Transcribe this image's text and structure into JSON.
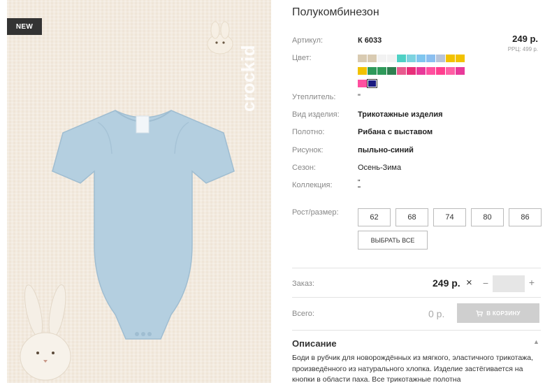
{
  "image": {
    "badge": "NEW",
    "watermark": "crockid",
    "product_color": "#b4cfe0"
  },
  "product": {
    "title": "Полукомбинезон",
    "price": "249 р.",
    "rrc": "РРЦ: 499 р."
  },
  "attributes": [
    {
      "label": "Артикул:",
      "value": "К 6033"
    },
    {
      "label": "Цвет:",
      "value": ""
    },
    {
      "label": "Утеплитель:",
      "value": "\""
    },
    {
      "label": "Вид изделия:",
      "value": "Трикотажные изделия"
    },
    {
      "label": "Полотно:",
      "value": "Рибана с выставом"
    },
    {
      "label": "Рисунок:",
      "value": "пыльно-синий"
    },
    {
      "label": "Сезон:",
      "value": "Осень-Зима"
    },
    {
      "label": "Коллекция:",
      "value": "\""
    },
    {
      "label": "Рост/размер:",
      "value": ""
    }
  ],
  "swatches": [
    "#d9cbb2",
    "#d9cbb2",
    "#f2f2f2",
    "#f2f2f2",
    "#4fd1c5",
    "#7dd3e0",
    "#7fc6ef",
    "#8bbff0",
    "#b7c4d9",
    "#f2c200",
    "#f2c200",
    "#f2c200",
    "#2e9a5a",
    "#2e9a5a",
    "#2e8050",
    "#e85a8e",
    "#e8307a",
    "#e83a9a",
    "#ff4f9f",
    "#ff3f8f",
    "#ff5fa5",
    "#e83a9a",
    "#ff4f9f",
    "#1a1a80"
  ],
  "selected_swatch": 23,
  "sizes": [
    "62",
    "68",
    "74",
    "80",
    "86"
  ],
  "select_all_label": "ВЫБРАТЬ ВСЕ",
  "order": {
    "label": "Заказ:",
    "price": "249 р.",
    "times": "×",
    "minus": "−",
    "plus": "+",
    "qty": ""
  },
  "total": {
    "label": "Всего:",
    "value": "0 р.",
    "cart_label": "В КОРЗИНУ"
  },
  "description": {
    "title": "Описание",
    "toggle": "▲",
    "text": "Боди в рубчик для новорождённых из мягкого, эластичного трикотажа, произведённого из натурального хлопка. Изделие застёгивается на кнопки в области паха. Все трикотажные полотна"
  }
}
